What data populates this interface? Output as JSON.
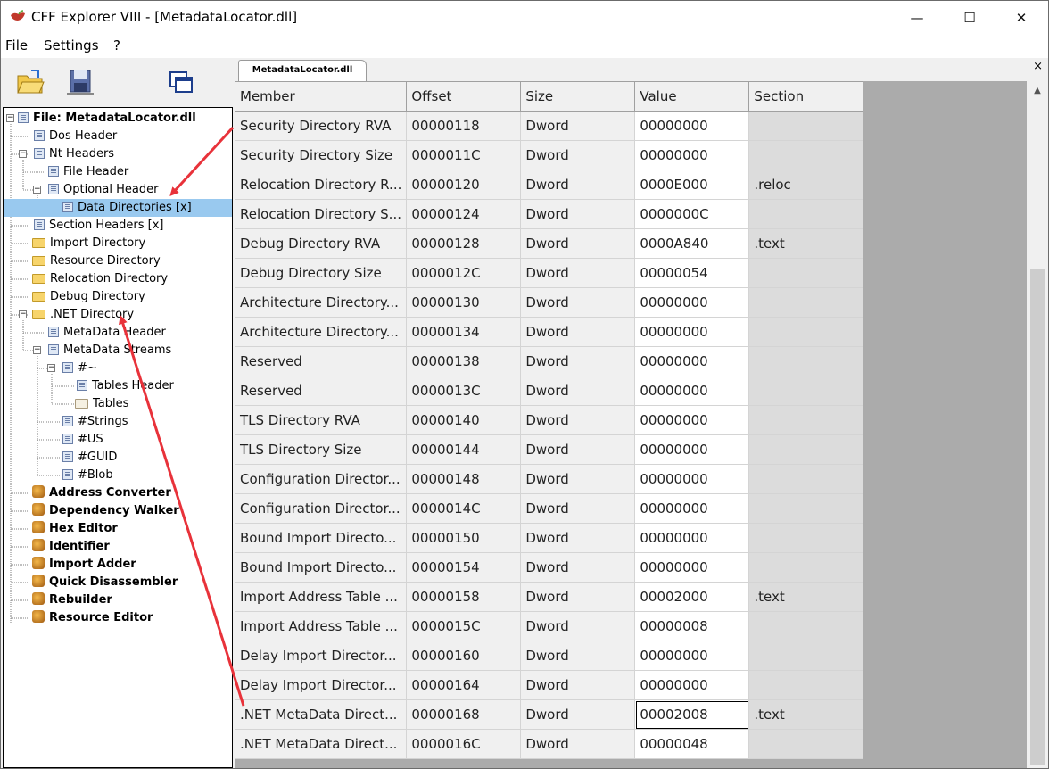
{
  "window": {
    "title": "CFF Explorer VIII - [MetadataLocator.dll]",
    "controls": [
      "—",
      "☐",
      "✕"
    ]
  },
  "menu": [
    "File",
    "Settings",
    "?"
  ],
  "toolbar": [
    "open-icon",
    "save-icon",
    "windows-icon"
  ],
  "tree": {
    "root": "File: MetadataLocator.dll",
    "items": [
      {
        "label": "Dos Header"
      },
      {
        "label": "Nt Headers"
      },
      {
        "label": "File Header"
      },
      {
        "label": "Optional Header"
      },
      {
        "label": "Data Directories [x]"
      },
      {
        "label": "Section Headers [x]"
      },
      {
        "label": "Import Directory"
      },
      {
        "label": "Resource Directory"
      },
      {
        "label": "Relocation Directory"
      },
      {
        "label": "Debug Directory"
      },
      {
        "label": ".NET Directory"
      },
      {
        "label": "MetaData Header"
      },
      {
        "label": "MetaData Streams"
      },
      {
        "label": "#~"
      },
      {
        "label": "Tables Header"
      },
      {
        "label": "Tables"
      },
      {
        "label": "#Strings"
      },
      {
        "label": "#US"
      },
      {
        "label": "#GUID"
      },
      {
        "label": "#Blob"
      },
      {
        "label": "Address Converter"
      },
      {
        "label": "Dependency Walker"
      },
      {
        "label": "Hex Editor"
      },
      {
        "label": "Identifier"
      },
      {
        "label": "Import Adder"
      },
      {
        "label": "Quick Disassembler"
      },
      {
        "label": "Rebuilder"
      },
      {
        "label": "Resource Editor"
      }
    ]
  },
  "tab": {
    "label": "MetadataLocator.dll",
    "close": "×"
  },
  "grid": {
    "columns": [
      "Member",
      "Offset",
      "Size",
      "Value",
      "Section"
    ],
    "rows": [
      [
        "Security Directory RVA",
        "00000118",
        "Dword",
        "00000000",
        ""
      ],
      [
        "Security Directory Size",
        "0000011C",
        "Dword",
        "00000000",
        ""
      ],
      [
        "Relocation Directory R...",
        "00000120",
        "Dword",
        "0000E000",
        ".reloc"
      ],
      [
        "Relocation Directory S...",
        "00000124",
        "Dword",
        "0000000C",
        ""
      ],
      [
        "Debug Directory RVA",
        "00000128",
        "Dword",
        "0000A840",
        ".text"
      ],
      [
        "Debug Directory Size",
        "0000012C",
        "Dword",
        "00000054",
        ""
      ],
      [
        "Architecture Directory...",
        "00000130",
        "Dword",
        "00000000",
        ""
      ],
      [
        "Architecture Directory...",
        "00000134",
        "Dword",
        "00000000",
        ""
      ],
      [
        "Reserved",
        "00000138",
        "Dword",
        "00000000",
        ""
      ],
      [
        "Reserved",
        "0000013C",
        "Dword",
        "00000000",
        ""
      ],
      [
        "TLS Directory RVA",
        "00000140",
        "Dword",
        "00000000",
        ""
      ],
      [
        "TLS Directory Size",
        "00000144",
        "Dword",
        "00000000",
        ""
      ],
      [
        "Configuration Director...",
        "00000148",
        "Dword",
        "00000000",
        ""
      ],
      [
        "Configuration Director...",
        "0000014C",
        "Dword",
        "00000000",
        ""
      ],
      [
        "Bound Import Directo...",
        "00000150",
        "Dword",
        "00000000",
        ""
      ],
      [
        "Bound Import Directo...",
        "00000154",
        "Dword",
        "00000000",
        ""
      ],
      [
        "Import Address Table ...",
        "00000158",
        "Dword",
        "00002000",
        ".text"
      ],
      [
        "Import Address Table ...",
        "0000015C",
        "Dword",
        "00000008",
        ""
      ],
      [
        "Delay Import Director...",
        "00000160",
        "Dword",
        "00000000",
        ""
      ],
      [
        "Delay Import Director...",
        "00000164",
        "Dword",
        "00000000",
        ""
      ],
      [
        ".NET MetaData Direct...",
        "00000168",
        "Dword",
        "00002008",
        ".text"
      ],
      [
        ".NET MetaData Direct...",
        "0000016C",
        "Dword",
        "00000048",
        ""
      ]
    ]
  },
  "colors": {
    "selection": "#99c9ef",
    "annotation": "#e8323a"
  }
}
